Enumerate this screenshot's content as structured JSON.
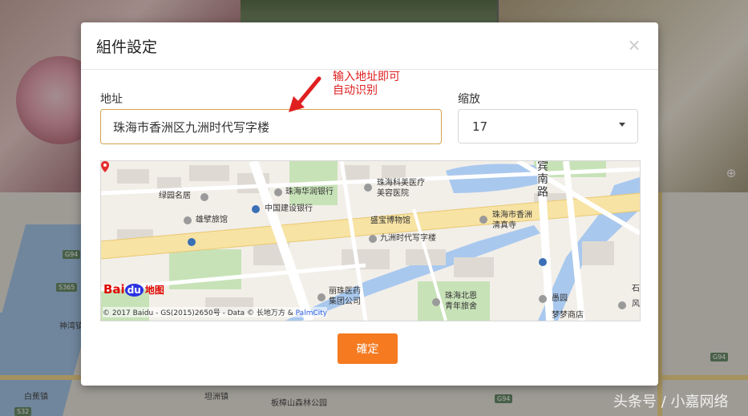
{
  "modal": {
    "title": "組件設定",
    "close_label": "×",
    "address_label": "地址",
    "address_value": "珠海市香洲区九洲时代写字楼",
    "zoom_label": "缩放",
    "zoom_value": "17",
    "confirm_label": "確定"
  },
  "annotation": {
    "line1": "输入地址即可",
    "line2": "自动识别"
  },
  "map": {
    "labels": {
      "l1": "绿园名居",
      "l2": "珠海华润银行",
      "l3": "珠海科美医疗",
      "l4": "美容医院",
      "l5": "宾",
      "l6": "南",
      "l7": "路",
      "l8": "中国建设银行",
      "l9": "雄擘旅馆",
      "l10": "盛宝博物馆",
      "l11": "九洲时代写字楼",
      "l12": "珠海市香洲",
      "l13": "清真寺",
      "l14": "丽珠医药",
      "l15": "集团公司",
      "l16": "珠海北恩",
      "l17": "青年旅舍",
      "l18": "愚园",
      "l19": "梦梦商店",
      "l20": "风",
      "l21": "石"
    },
    "logo": {
      "bai": "Bai",
      "du": "du",
      "ditu": "地图"
    },
    "copyright": "© 2017 Baidu - GS(2015)2650号 - Data © 长地万方 &",
    "palmcity": "PalmCity"
  },
  "background": {
    "labels": {
      "g94_a": "G94",
      "s365": "S365",
      "shenhe": "神湾镇",
      "baijiao": "白蕉镇",
      "tanzhou": "坦洲镇",
      "banzhang": "板樟山森林公园",
      "g94_b": "G94",
      "g94_c": "G94",
      "s32": "S32"
    }
  },
  "watermark": "头条号 / 小嘉网络",
  "colors": {
    "accent": "#f57a20",
    "annotation": "#e02020",
    "input_border": "#d4a24c"
  },
  "icons": [
    "close-icon",
    "caret-down-icon",
    "arrow-icon",
    "map-marker-icon",
    "zoom-in-icon"
  ]
}
